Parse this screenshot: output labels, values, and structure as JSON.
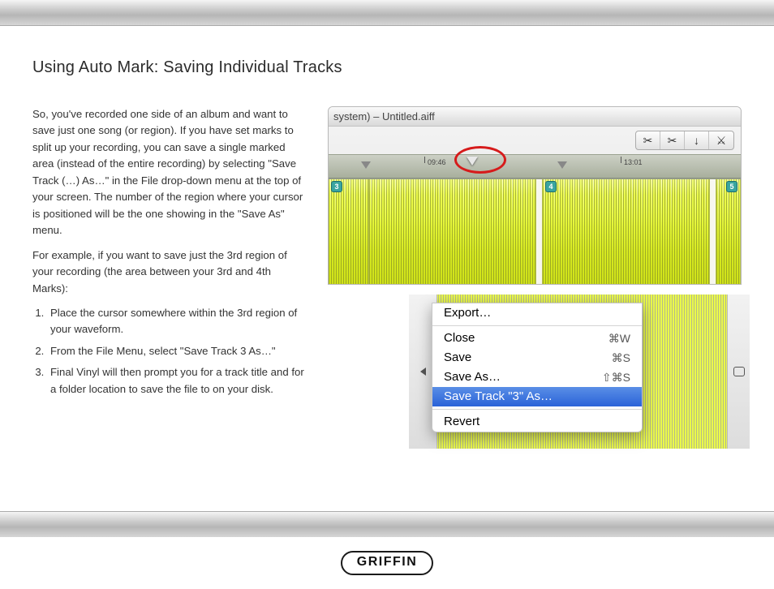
{
  "page": {
    "title": "Using Auto Mark: Saving Individual Tracks",
    "para1": "So, you've recorded one side of an album and want to save just one song (or region). If you have set marks to split up your recording, you can save a single marked area (instead of the entire recording) by selecting \"Save Track (…) As…\" in the File drop-down menu at the top of your screen. The number of the region where your cursor is positioned will be the one showing in the \"Save As\" menu.",
    "para2": "For example, if you want to save just the 3rd region of your recording (the area between your 3rd and 4th Marks):",
    "steps": [
      "Place the cursor somewhere within the 3rd region of your waveform.",
      "From the File Menu, select \"Save Track 3 As…\"",
      "Final Vinyl will then prompt you for a track title and for a folder location to save the file to on your disk."
    ]
  },
  "waveform": {
    "window_title": "system) – Untitled.aiff",
    "time_labels": {
      "t1": "09:46",
      "t2": "13:01"
    },
    "regions": {
      "r3": "3",
      "r4": "4",
      "r5": "5"
    }
  },
  "menu": {
    "export": "Export…",
    "close": "Close",
    "close_sc": "⌘W",
    "save": "Save",
    "save_sc": "⌘S",
    "saveas": "Save As…",
    "saveas_sc": "⇧⌘S",
    "savetrack": "Save Track \"3\" As…",
    "revert": "Revert"
  },
  "footer": {
    "brand": "GRIFFIN"
  }
}
